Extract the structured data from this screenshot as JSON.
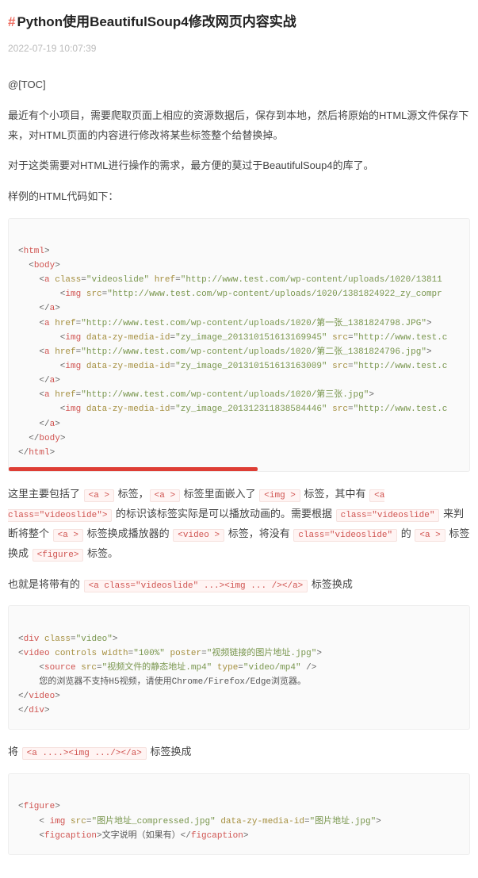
{
  "header": {
    "hash": "#",
    "title": "Python使用BeautifulSoup4修改网页内容实战",
    "timestamp": "2022-07-19 10:07:39"
  },
  "blocks": [
    {
      "type": "para",
      "text": "@[TOC]"
    },
    {
      "type": "para",
      "text": "最近有个小项目，需要爬取页面上相应的资源数据后，保存到本地，然后将原始的HTML源文件保存下来，对HTML页面的内容进行修改将某些标签整个给替换掉。"
    },
    {
      "type": "para",
      "text": "对于这类需要对HTML进行操作的需求，最方便的莫过于BeautifulSoup4的库了。"
    },
    {
      "type": "para",
      "text": "样例的HTML代码如下："
    },
    {
      "type": "code",
      "id": "c1",
      "scroll": true
    },
    {
      "type": "richpara",
      "id": "p1"
    },
    {
      "type": "richpara",
      "id": "p2"
    },
    {
      "type": "code",
      "id": "c2"
    },
    {
      "type": "richpara",
      "id": "p3"
    },
    {
      "type": "code",
      "id": "c3"
    }
  ],
  "code": {
    "c1": {
      "html_open": "html",
      "html_close": "html",
      "body_open": "body",
      "body_close": "body",
      "a": "a",
      "img": "img",
      "class_attr": "class",
      "href_attr": "href",
      "src_attr": "src",
      "media_attr": "data-zy-media-id",
      "videoslide": "videoslide",
      "href1": "http://www.test.com/wp-content/uploads/1020/13811",
      "src1": "http://www.test.com/wp-content/uploads/1020/1381824922_zy_compr",
      "href2": "http://www.test.com/wp-content/uploads/1020/第一张_1381824798.JPG",
      "mid2": "zy_image_201310151613169945",
      "srcx": "http://www.test.c",
      "href3": "http://www.test.com/wp-content/uploads/1020/第二张_1381824796.jpg",
      "mid3": "zy_image_201310151613163009",
      "href4": "http://www.test.com/wp-content/uploads/1020/第三张.jpg",
      "mid4": "zy_image_201312311838584446"
    },
    "c2": {
      "div": "div",
      "video": "video",
      "source": "source",
      "class_attr": "class",
      "controls_attr": "controls",
      "width_attr": "width",
      "poster_attr": "poster",
      "src_attr": "src",
      "type_attr": "type",
      "video_cls": "video",
      "width_v": "100%",
      "poster_v": "视频链接的图片地址.jpg",
      "src_v": "视频文件的静态地址.mp4",
      "type_v": "video/mp4",
      "fallback": "您的浏览器不支持H5视频，请使用Chrome/Firefox/Edge浏览器。"
    },
    "c3": {
      "figure": "figure",
      "img": "img",
      "figcaption": "figcaption",
      "src_attr": "src",
      "media_attr": "data-zy-media-id",
      "src_v": "图片地址_compressed.jpg",
      "mid_v": "图片地址.jpg",
      "caption": "文字说明（如果有）"
    }
  },
  "rich": {
    "p1": {
      "t1": "这里主要包括了 ",
      "c1": "<a >",
      "t2": " 标签，",
      "c2": "<a >",
      "t3": " 标签里面嵌入了 ",
      "c3": "<img >",
      "t4": " 标签，其中有 ",
      "c4": "<a class=\"videoslide\">",
      "t5": " 的标识该标签实际是可以播放动画的。需要根据 ",
      "c5": "class=\"videoslide\"",
      "t6": " 来判断将整个 ",
      "c6": "<a >",
      "t7": " 标签换成播放器的 ",
      "c7": "<video >",
      "t8": " 标签，将没有 ",
      "c8": "class=\"videoslide\"",
      "t9": " 的 ",
      "c9": "<a >",
      "t10": " 标签换成 ",
      "c10": "<figure>",
      "t11": " 标签。"
    },
    "p2": {
      "t1": "也就是将带有的 ",
      "c1": "<a class=\"videoslide\" ...><img ... /></a>",
      "t2": " 标签换成"
    },
    "p3": {
      "t1": "将 ",
      "c1": "<a ....><img .../></a>",
      "t2": " 标签换成"
    }
  }
}
